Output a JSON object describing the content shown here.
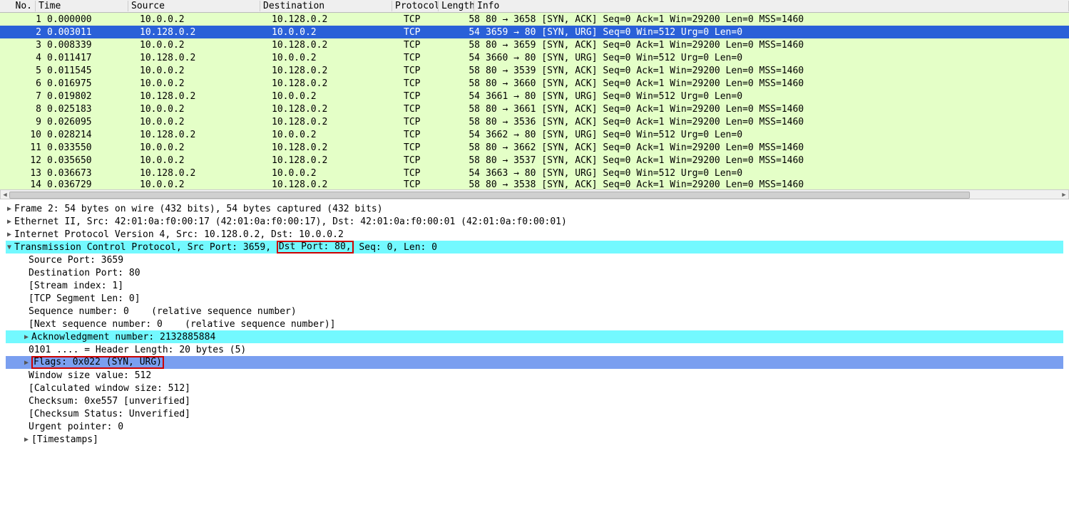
{
  "columns": {
    "no": "No.",
    "time": "Time",
    "src": "Source",
    "dst": "Destination",
    "proto": "Protocol",
    "len": "Length",
    "info": "Info"
  },
  "packets": [
    {
      "no": "1",
      "time": "0.000000",
      "src": "10.0.0.2",
      "dst": "10.128.0.2",
      "proto": "TCP",
      "len": "58",
      "info": "80 → 3658 [SYN, ACK] Seq=0 Ack=1 Win=29200 Len=0 MSS=1460"
    },
    {
      "no": "2",
      "time": "0.003011",
      "src": "10.128.0.2",
      "dst": "10.0.0.2",
      "proto": "TCP",
      "len": "54",
      "info": "3659 → 80 [SYN, URG] Seq=0 Win=512 Urg=0 Len=0"
    },
    {
      "no": "3",
      "time": "0.008339",
      "src": "10.0.0.2",
      "dst": "10.128.0.2",
      "proto": "TCP",
      "len": "58",
      "info": "80 → 3659 [SYN, ACK] Seq=0 Ack=1 Win=29200 Len=0 MSS=1460"
    },
    {
      "no": "4",
      "time": "0.011417",
      "src": "10.128.0.2",
      "dst": "10.0.0.2",
      "proto": "TCP",
      "len": "54",
      "info": "3660 → 80 [SYN, URG] Seq=0 Win=512 Urg=0 Len=0"
    },
    {
      "no": "5",
      "time": "0.011545",
      "src": "10.0.0.2",
      "dst": "10.128.0.2",
      "proto": "TCP",
      "len": "58",
      "info": "80 → 3539 [SYN, ACK] Seq=0 Ack=1 Win=29200 Len=0 MSS=1460"
    },
    {
      "no": "6",
      "time": "0.016975",
      "src": "10.0.0.2",
      "dst": "10.128.0.2",
      "proto": "TCP",
      "len": "58",
      "info": "80 → 3660 [SYN, ACK] Seq=0 Ack=1 Win=29200 Len=0 MSS=1460"
    },
    {
      "no": "7",
      "time": "0.019802",
      "src": "10.128.0.2",
      "dst": "10.0.0.2",
      "proto": "TCP",
      "len": "54",
      "info": "3661 → 80 [SYN, URG] Seq=0 Win=512 Urg=0 Len=0"
    },
    {
      "no": "8",
      "time": "0.025183",
      "src": "10.0.0.2",
      "dst": "10.128.0.2",
      "proto": "TCP",
      "len": "58",
      "info": "80 → 3661 [SYN, ACK] Seq=0 Ack=1 Win=29200 Len=0 MSS=1460"
    },
    {
      "no": "9",
      "time": "0.026095",
      "src": "10.0.0.2",
      "dst": "10.128.0.2",
      "proto": "TCP",
      "len": "58",
      "info": "80 → 3536 [SYN, ACK] Seq=0 Ack=1 Win=29200 Len=0 MSS=1460"
    },
    {
      "no": "10",
      "time": "0.028214",
      "src": "10.128.0.2",
      "dst": "10.0.0.2",
      "proto": "TCP",
      "len": "54",
      "info": "3662 → 80 [SYN, URG] Seq=0 Win=512 Urg=0 Len=0"
    },
    {
      "no": "11",
      "time": "0.033550",
      "src": "10.0.0.2",
      "dst": "10.128.0.2",
      "proto": "TCP",
      "len": "58",
      "info": "80 → 3662 [SYN, ACK] Seq=0 Ack=1 Win=29200 Len=0 MSS=1460"
    },
    {
      "no": "12",
      "time": "0.035650",
      "src": "10.0.0.2",
      "dst": "10.128.0.2",
      "proto": "TCP",
      "len": "58",
      "info": "80 → 3537 [SYN, ACK] Seq=0 Ack=1 Win=29200 Len=0 MSS=1460"
    },
    {
      "no": "13",
      "time": "0.036673",
      "src": "10.128.0.2",
      "dst": "10.0.0.2",
      "proto": "TCP",
      "len": "54",
      "info": "3663 → 80 [SYN, URG] Seq=0 Win=512 Urg=0 Len=0"
    },
    {
      "no": "14",
      "time": "0.036729",
      "src": "10.0.0.2",
      "dst": "10.128.0.2",
      "proto": "TCP",
      "len": "58",
      "info": "80 → 3538 [SYN, ACK] Seq=0 Ack=1 Win=29200 Len=0 MSS=1460"
    }
  ],
  "selected_index": 1,
  "details": {
    "frame": "Frame 2: 54 bytes on wire (432 bits), 54 bytes captured (432 bits)",
    "eth": "Ethernet II, Src: 42:01:0a:f0:00:17 (42:01:0a:f0:00:17), Dst: 42:01:0a:f0:00:01 (42:01:0a:f0:00:01)",
    "ip": "Internet Protocol Version 4, Src: 10.128.0.2, Dst: 10.0.0.2",
    "tcp_pre": "Transmission Control Protocol, Src Port: 3659, ",
    "tcp_box": "Dst Port: 80,",
    "tcp_post": " Seq: 0, Len: 0",
    "src_port": "Source Port: 3659",
    "dst_port": "Destination Port: 80",
    "stream": "[Stream index: 1]",
    "seglen": "[TCP Segment Len: 0]",
    "seq": "Sequence number: 0    (relative sequence number)",
    "nseq": "[Next sequence number: 0    (relative sequence number)]",
    "ack": "Acknowledgment number: 2132885884",
    "hlen": "0101 .... = Header Length: 20 bytes (5)",
    "flags": "Flags: 0x022 (SYN, URG)",
    "win": "Window size value: 512",
    "cwin": "[Calculated window size: 512]",
    "cksum": "Checksum: 0xe557 [unverified]",
    "ckstat": "[Checksum Status: Unverified]",
    "urg": "Urgent pointer: 0",
    "ts": "[Timestamps]"
  }
}
